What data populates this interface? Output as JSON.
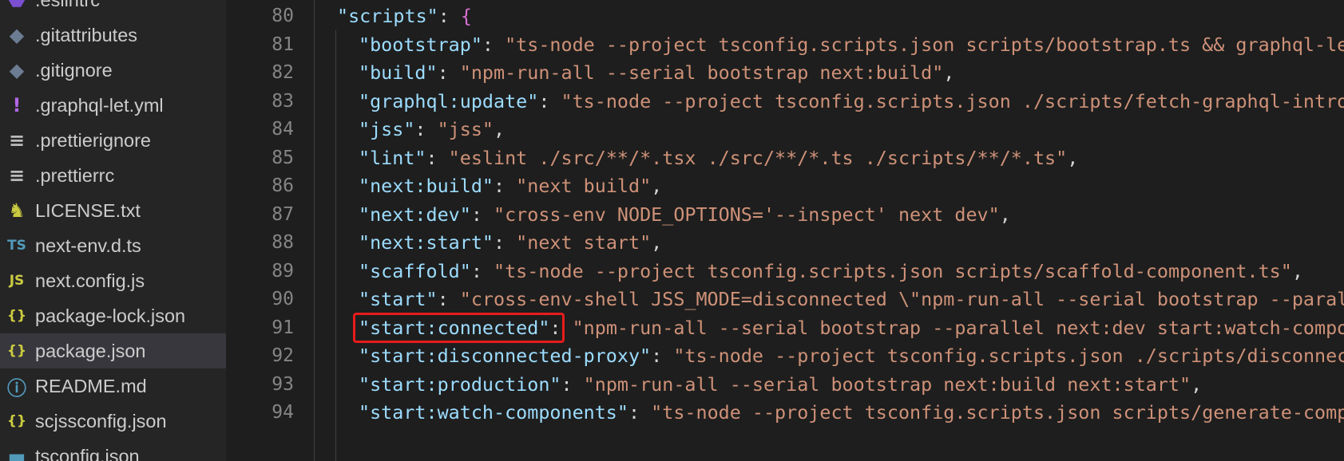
{
  "sidebar": {
    "files": [
      {
        "name": ".eslintrc",
        "icon": "eslint-icon",
        "color": "#7b4fd1",
        "glyph": "⬣"
      },
      {
        "name": ".gitattributes",
        "icon": "git-icon",
        "color": "#6c7d93",
        "glyph": "◆"
      },
      {
        "name": ".gitignore",
        "icon": "git-icon",
        "color": "#6c7d93",
        "glyph": "◆"
      },
      {
        "name": ".graphql-let.yml",
        "icon": "yaml-icon",
        "color": "#b267e6",
        "glyph": "!"
      },
      {
        "name": ".prettierignore",
        "icon": "lines-icon",
        "color": "#bbbbbb",
        "glyph": "≡"
      },
      {
        "name": ".prettierrc",
        "icon": "lines-icon",
        "color": "#bbbbbb",
        "glyph": "≡"
      },
      {
        "name": "LICENSE.txt",
        "icon": "license-icon",
        "color": "#cbcb41",
        "glyph": "♞"
      },
      {
        "name": "next-env.d.ts",
        "icon": "typescript-icon",
        "color": "#519aba",
        "glyph": "TS"
      },
      {
        "name": "next.config.js",
        "icon": "javascript-icon",
        "color": "#cbcb41",
        "glyph": "JS"
      },
      {
        "name": "package-lock.json",
        "icon": "json-icon",
        "color": "#cbcb41",
        "glyph": "{}"
      },
      {
        "name": "package.json",
        "icon": "json-icon",
        "color": "#cbcb41",
        "glyph": "{}",
        "active": true
      },
      {
        "name": "README.md",
        "icon": "info-icon",
        "color": "#519aba",
        "glyph": "ⓘ"
      },
      {
        "name": "scjssconfig.json",
        "icon": "json-icon",
        "color": "#cbcb41",
        "glyph": "{}"
      },
      {
        "name": "tsconfig.json",
        "icon": "tsconfig-icon",
        "color": "#519aba",
        "glyph": "▬"
      }
    ]
  },
  "editor": {
    "lines": [
      {
        "num": "80",
        "indent": 1,
        "key": "\"scripts\"",
        "sep": ": ",
        "value": "",
        "tail": "{"
      },
      {
        "num": "81",
        "indent": 2,
        "key": "\"bootstrap\"",
        "sep": ": ",
        "value": "\"ts-node --project tsconfig.scripts.json scripts/bootstrap.ts && graphql-let\"",
        "tail": ","
      },
      {
        "num": "82",
        "indent": 2,
        "key": "\"build\"",
        "sep": ": ",
        "value": "\"npm-run-all --serial bootstrap next:build\"",
        "tail": ","
      },
      {
        "num": "83",
        "indent": 2,
        "key": "\"graphql:update\"",
        "sep": ": ",
        "value": "\"ts-node --project tsconfig.scripts.json ./scripts/fetch-graphql-introspection-data.ts\"",
        "tail": ","
      },
      {
        "num": "84",
        "indent": 2,
        "key": "\"jss\"",
        "sep": ": ",
        "value": "\"jss\"",
        "tail": ","
      },
      {
        "num": "85",
        "indent": 2,
        "key": "\"lint\"",
        "sep": ": ",
        "value": "\"eslint ./src/**/*.tsx ./src/**/*.ts ./scripts/**/*.ts\"",
        "tail": ","
      },
      {
        "num": "86",
        "indent": 2,
        "key": "\"next:build\"",
        "sep": ": ",
        "value": "\"next build\"",
        "tail": ","
      },
      {
        "num": "87",
        "indent": 2,
        "key": "\"next:dev\"",
        "sep": ": ",
        "value": "\"cross-env NODE_OPTIONS='--inspect' next dev\"",
        "tail": ","
      },
      {
        "num": "88",
        "indent": 2,
        "key": "\"next:start\"",
        "sep": ": ",
        "value": "\"next start\"",
        "tail": ","
      },
      {
        "num": "89",
        "indent": 2,
        "key": "\"scaffold\"",
        "sep": ": ",
        "value": "\"ts-node --project tsconfig.scripts.json scripts/scaffold-component.ts\"",
        "tail": ","
      },
      {
        "num": "90",
        "indent": 2,
        "key": "\"start\"",
        "sep": ": ",
        "value": "\"cross-env-shell JSS_MODE=disconnected \\\"npm-run-all --serial bootstrap --parallel next:dev start:disconnected-proxy start:watch-components\\\"\"",
        "tail": ","
      },
      {
        "num": "91",
        "indent": 2,
        "key": "\"start:connected\"",
        "sep": ": ",
        "value": "\"npm-run-all --serial bootstrap --parallel next:dev start:watch-components\"",
        "tail": ","
      },
      {
        "num": "92",
        "indent": 2,
        "key": "\"start:disconnected-proxy\"",
        "sep": ": ",
        "value": "\"ts-node --project tsconfig.scripts.json ./scripts/disconnected-mode-proxy.ts\"",
        "tail": ","
      },
      {
        "num": "93",
        "indent": 2,
        "key": "\"start:production\"",
        "sep": ": ",
        "value": "\"npm-run-all --serial bootstrap next:build next:start\"",
        "tail": ","
      },
      {
        "num": "94",
        "indent": 2,
        "key": "\"start:watch-components\"",
        "sep": ": ",
        "value": "\"ts-node --project tsconfig.scripts.json scripts/generate-component-factory.ts --watch\"",
        "tail": ","
      }
    ],
    "highlighted_line": "91"
  },
  "colors": {
    "key": "#9cdcfe",
    "string": "#ce9178",
    "punctuation": "#d4d4d4",
    "brace": "#da70d6",
    "highlight_border": "#e81b1b",
    "sidebar_bg": "#252526",
    "editor_bg": "#1e1e1e"
  }
}
